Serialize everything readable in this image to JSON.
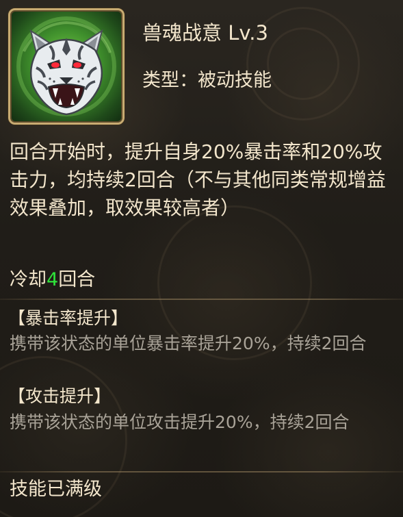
{
  "skill": {
    "icon": "white-tiger-head-icon",
    "title": "兽魂战意 Lv.3",
    "type_label": "类型：被动技能",
    "description": "回合开始时，提升自身20%暴击率和20%攻击力，均持续2回合（不与其他同类常规增益效果叠加，取效果较高者）",
    "cooldown_prefix": "冷却",
    "cooldown_value": "4",
    "cooldown_suffix": "回合"
  },
  "buffs": [
    {
      "name": "【暴击率提升】",
      "description": "携带该状态的单位暴击率提升20%，持续2回合"
    },
    {
      "name": "【攻击提升】",
      "description": "携带该状态的单位攻击提升20%，持续2回合"
    }
  ],
  "status": {
    "maxed": "技能已满级"
  },
  "colors": {
    "text_primary": "#f3e6cc",
    "text_secondary": "#a9a398",
    "cooldown_number": "#2fe33a",
    "icon_border": "#c8ab72",
    "icon_glow": "#7cd24a"
  }
}
